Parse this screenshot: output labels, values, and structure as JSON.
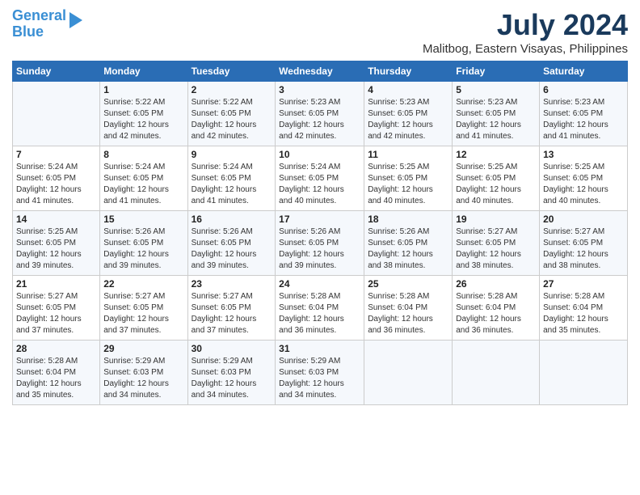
{
  "header": {
    "logo_line1": "General",
    "logo_line2": "Blue",
    "month_year": "July 2024",
    "location": "Malitbog, Eastern Visayas, Philippines"
  },
  "days_of_week": [
    "Sunday",
    "Monday",
    "Tuesday",
    "Wednesday",
    "Thursday",
    "Friday",
    "Saturday"
  ],
  "weeks": [
    [
      {
        "day": "",
        "info": ""
      },
      {
        "day": "1",
        "info": "Sunrise: 5:22 AM\nSunset: 6:05 PM\nDaylight: 12 hours\nand 42 minutes."
      },
      {
        "day": "2",
        "info": "Sunrise: 5:22 AM\nSunset: 6:05 PM\nDaylight: 12 hours\nand 42 minutes."
      },
      {
        "day": "3",
        "info": "Sunrise: 5:23 AM\nSunset: 6:05 PM\nDaylight: 12 hours\nand 42 minutes."
      },
      {
        "day": "4",
        "info": "Sunrise: 5:23 AM\nSunset: 6:05 PM\nDaylight: 12 hours\nand 42 minutes."
      },
      {
        "day": "5",
        "info": "Sunrise: 5:23 AM\nSunset: 6:05 PM\nDaylight: 12 hours\nand 41 minutes."
      },
      {
        "day": "6",
        "info": "Sunrise: 5:23 AM\nSunset: 6:05 PM\nDaylight: 12 hours\nand 41 minutes."
      }
    ],
    [
      {
        "day": "7",
        "info": "Sunrise: 5:24 AM\nSunset: 6:05 PM\nDaylight: 12 hours\nand 41 minutes."
      },
      {
        "day": "8",
        "info": "Sunrise: 5:24 AM\nSunset: 6:05 PM\nDaylight: 12 hours\nand 41 minutes."
      },
      {
        "day": "9",
        "info": "Sunrise: 5:24 AM\nSunset: 6:05 PM\nDaylight: 12 hours\nand 41 minutes."
      },
      {
        "day": "10",
        "info": "Sunrise: 5:24 AM\nSunset: 6:05 PM\nDaylight: 12 hours\nand 40 minutes."
      },
      {
        "day": "11",
        "info": "Sunrise: 5:25 AM\nSunset: 6:05 PM\nDaylight: 12 hours\nand 40 minutes."
      },
      {
        "day": "12",
        "info": "Sunrise: 5:25 AM\nSunset: 6:05 PM\nDaylight: 12 hours\nand 40 minutes."
      },
      {
        "day": "13",
        "info": "Sunrise: 5:25 AM\nSunset: 6:05 PM\nDaylight: 12 hours\nand 40 minutes."
      }
    ],
    [
      {
        "day": "14",
        "info": "Sunrise: 5:25 AM\nSunset: 6:05 PM\nDaylight: 12 hours\nand 39 minutes."
      },
      {
        "day": "15",
        "info": "Sunrise: 5:26 AM\nSunset: 6:05 PM\nDaylight: 12 hours\nand 39 minutes."
      },
      {
        "day": "16",
        "info": "Sunrise: 5:26 AM\nSunset: 6:05 PM\nDaylight: 12 hours\nand 39 minutes."
      },
      {
        "day": "17",
        "info": "Sunrise: 5:26 AM\nSunset: 6:05 PM\nDaylight: 12 hours\nand 39 minutes."
      },
      {
        "day": "18",
        "info": "Sunrise: 5:26 AM\nSunset: 6:05 PM\nDaylight: 12 hours\nand 38 minutes."
      },
      {
        "day": "19",
        "info": "Sunrise: 5:27 AM\nSunset: 6:05 PM\nDaylight: 12 hours\nand 38 minutes."
      },
      {
        "day": "20",
        "info": "Sunrise: 5:27 AM\nSunset: 6:05 PM\nDaylight: 12 hours\nand 38 minutes."
      }
    ],
    [
      {
        "day": "21",
        "info": "Sunrise: 5:27 AM\nSunset: 6:05 PM\nDaylight: 12 hours\nand 37 minutes."
      },
      {
        "day": "22",
        "info": "Sunrise: 5:27 AM\nSunset: 6:05 PM\nDaylight: 12 hours\nand 37 minutes."
      },
      {
        "day": "23",
        "info": "Sunrise: 5:27 AM\nSunset: 6:05 PM\nDaylight: 12 hours\nand 37 minutes."
      },
      {
        "day": "24",
        "info": "Sunrise: 5:28 AM\nSunset: 6:04 PM\nDaylight: 12 hours\nand 36 minutes."
      },
      {
        "day": "25",
        "info": "Sunrise: 5:28 AM\nSunset: 6:04 PM\nDaylight: 12 hours\nand 36 minutes."
      },
      {
        "day": "26",
        "info": "Sunrise: 5:28 AM\nSunset: 6:04 PM\nDaylight: 12 hours\nand 36 minutes."
      },
      {
        "day": "27",
        "info": "Sunrise: 5:28 AM\nSunset: 6:04 PM\nDaylight: 12 hours\nand 35 minutes."
      }
    ],
    [
      {
        "day": "28",
        "info": "Sunrise: 5:28 AM\nSunset: 6:04 PM\nDaylight: 12 hours\nand 35 minutes."
      },
      {
        "day": "29",
        "info": "Sunrise: 5:29 AM\nSunset: 6:03 PM\nDaylight: 12 hours\nand 34 minutes."
      },
      {
        "day": "30",
        "info": "Sunrise: 5:29 AM\nSunset: 6:03 PM\nDaylight: 12 hours\nand 34 minutes."
      },
      {
        "day": "31",
        "info": "Sunrise: 5:29 AM\nSunset: 6:03 PM\nDaylight: 12 hours\nand 34 minutes."
      },
      {
        "day": "",
        "info": ""
      },
      {
        "day": "",
        "info": ""
      },
      {
        "day": "",
        "info": ""
      }
    ]
  ]
}
